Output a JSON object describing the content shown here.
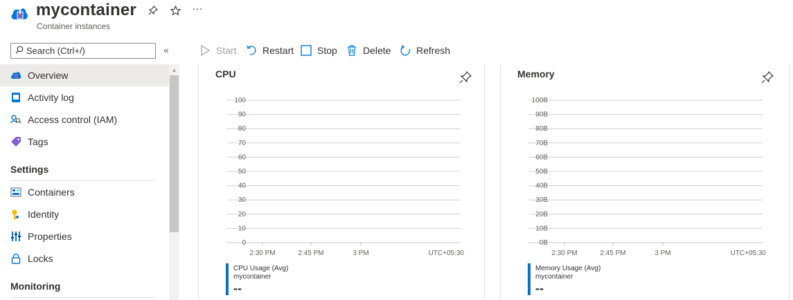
{
  "header": {
    "title": "mycontainer",
    "subtitle": "Container instances",
    "pin_icon": "pin-icon",
    "favorite_icon": "star-icon",
    "more_label": "···"
  },
  "search": {
    "placeholder": "Search (Ctrl+/)",
    "collapse_label": "«"
  },
  "sidebar": {
    "items": [
      {
        "label": "Overview",
        "icon": "container-cloud-icon",
        "active": true
      },
      {
        "label": "Activity log",
        "icon": "activity-log-icon"
      },
      {
        "label": "Access control (IAM)",
        "icon": "iam-icon"
      },
      {
        "label": "Tags",
        "icon": "tag-icon"
      }
    ],
    "settings_heading": "Settings",
    "settings_items": [
      {
        "label": "Containers",
        "icon": "containers-icon"
      },
      {
        "label": "Identity",
        "icon": "identity-key-icon"
      },
      {
        "label": "Properties",
        "icon": "properties-icon"
      },
      {
        "label": "Locks",
        "icon": "lock-icon"
      }
    ],
    "monitoring_heading": "Monitoring"
  },
  "toolbar": {
    "start": "Start",
    "restart": "Restart",
    "stop": "Stop",
    "delete": "Delete",
    "refresh": "Refresh"
  },
  "colors": {
    "accent": "#0078d4",
    "series": "#106ebe",
    "grid": "#d2d0ce"
  },
  "chart_data": [
    {
      "type": "line",
      "title": "CPU",
      "y_ticks": [
        "100",
        "90",
        "80",
        "70",
        "60",
        "50",
        "40",
        "30",
        "20",
        "10",
        "0"
      ],
      "ylim": [
        0,
        100
      ],
      "x_ticks": [
        "2:30 PM",
        "2:45 PM",
        "3 PM"
      ],
      "timezone": "UTC+05:30",
      "series": [
        {
          "name": "CPU Usage (Avg)",
          "resource": "mycontainer",
          "value": "--"
        }
      ],
      "grid": true
    },
    {
      "type": "line",
      "title": "Memory",
      "y_ticks": [
        "100B",
        "90B",
        "80B",
        "70B",
        "60B",
        "50B",
        "40B",
        "30B",
        "20B",
        "10B",
        "0B"
      ],
      "ylim": [
        0,
        100
      ],
      "x_ticks": [
        "2:30 PM",
        "2:45 PM",
        "3 PM"
      ],
      "timezone": "UTC+05:30",
      "series": [
        {
          "name": "Memory Usage (Avg)",
          "resource": "mycontainer",
          "value": "--"
        }
      ],
      "grid": true
    }
  ]
}
